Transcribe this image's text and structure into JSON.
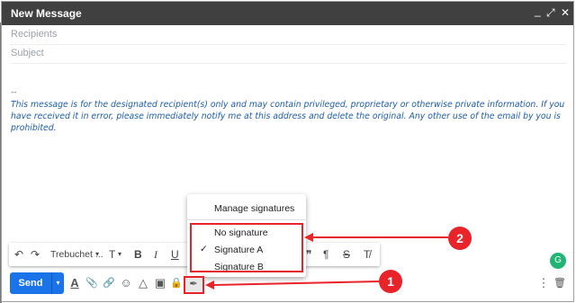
{
  "window": {
    "title": "New Message",
    "minimize": "_",
    "expand": "⤢",
    "close": "✕"
  },
  "compose": {
    "recipients_placeholder": "Recipients",
    "subject_placeholder": "Subject",
    "signature_dash": "--",
    "signature_text": "This message is for the designated recipient(s) only and may contain privileged, proprietary or otherwise private information. If you have received it in error, please immediately notify me at this address and delete the original. Any other use of the email by you is prohibited."
  },
  "format_toolbar": {
    "undo": "↶",
    "redo": "↷",
    "font": "Trebuchet ...",
    "font_caret": "▾",
    "size": "T",
    "size_caret": "▾",
    "bold": "B",
    "italic": "I",
    "underline": "U",
    "quote": "❞",
    "rtl": "¶",
    "strike": "S",
    "clear": "T̸"
  },
  "signature_menu": {
    "manage": "Manage signatures",
    "items": [
      {
        "label": "No signature",
        "checked": false
      },
      {
        "label": "Signature A",
        "checked": true
      },
      {
        "label": "Signature B",
        "checked": false
      }
    ],
    "check": "✓"
  },
  "bottom_toolbar": {
    "send": "Send",
    "send_caret": "▾",
    "format_text": "A",
    "attach": "📎",
    "link": "🔗",
    "emoji": "☺",
    "drive": "△",
    "photo": "▣",
    "lock": "🔒",
    "pen": "✒",
    "more": "⋮",
    "trash": "🗑"
  },
  "annotations": {
    "badge1": "1",
    "badge2": "2",
    "color": "#e8232a"
  }
}
